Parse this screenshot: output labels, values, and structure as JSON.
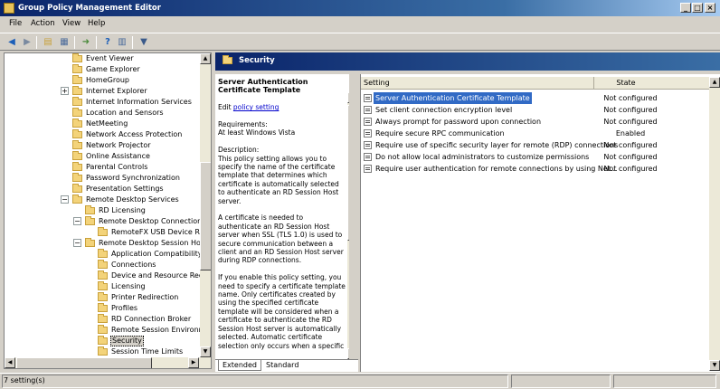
{
  "window": {
    "title": "Group Policy Management Editor"
  },
  "menu": [
    "File",
    "Action",
    "View",
    "Help"
  ],
  "tree": [
    {
      "label": "Event Viewer",
      "indent": 2
    },
    {
      "label": "Game Explorer",
      "indent": 2
    },
    {
      "label": "HomeGroup",
      "indent": 2
    },
    {
      "label": "Internet Explorer",
      "indent": 2,
      "expander": "+"
    },
    {
      "label": "Internet Information Services",
      "indent": 2
    },
    {
      "label": "Location and Sensors",
      "indent": 2
    },
    {
      "label": "NetMeeting",
      "indent": 2
    },
    {
      "label": "Network Access Protection",
      "indent": 2
    },
    {
      "label": "Network Projector",
      "indent": 2
    },
    {
      "label": "Online Assistance",
      "indent": 2
    },
    {
      "label": "Parental Controls",
      "indent": 2
    },
    {
      "label": "Password Synchronization",
      "indent": 2
    },
    {
      "label": "Presentation Settings",
      "indent": 2
    },
    {
      "label": "Remote Desktop Services",
      "indent": 2,
      "expander": "−"
    },
    {
      "label": "RD Licensing",
      "indent": 3
    },
    {
      "label": "Remote Desktop Connection Cli",
      "indent": 3,
      "expander": "−"
    },
    {
      "label": "RemoteFX USB Device Redi",
      "indent": 4
    },
    {
      "label": "Remote Desktop Session Host",
      "indent": 3,
      "expander": "−"
    },
    {
      "label": "Application Compatibility",
      "indent": 4
    },
    {
      "label": "Connections",
      "indent": 4
    },
    {
      "label": "Device and Resource Redire",
      "indent": 4
    },
    {
      "label": "Licensing",
      "indent": 4
    },
    {
      "label": "Printer Redirection",
      "indent": 4
    },
    {
      "label": "Profiles",
      "indent": 4
    },
    {
      "label": "RD Connection Broker",
      "indent": 4
    },
    {
      "label": "Remote Session Environmen",
      "indent": 4
    },
    {
      "label": "Security",
      "indent": 4,
      "selected": true
    },
    {
      "label": "Session Time Limits",
      "indent": 4
    }
  ],
  "right": {
    "header": "Security",
    "description": {
      "title": "Server Authentication Certificate Template",
      "edit_prefix": "Edit ",
      "edit_link": "policy setting",
      "paragraphs": [
        "Requirements:\nAt least Windows Vista",
        "Description:\nThis policy setting allows you to specify the name of the certificate template that determines which certificate is automatically selected to authenticate an RD Session Host server.",
        "A certificate is needed to authenticate an RD Session Host server when SSL (TLS 1.0) is used to secure communication between a client and an RD Session Host server during RDP connections.",
        "If you enable this policy setting, you need to specify a certificate template name. Only certificates created by using the specified certificate template will be considered when a certificate to authenticate the RD Session Host server is automatically selected. Automatic certificate selection only occurs when a specific"
      ]
    },
    "tabs": [
      "Extended",
      "Standard"
    ],
    "columns": {
      "setting": "Setting",
      "state": "State"
    },
    "rows": [
      {
        "name": "Server Authentication Certificate Template",
        "state": "Not configured",
        "selected": true
      },
      {
        "name": "Set client connection encryption level",
        "state": "Not configured"
      },
      {
        "name": "Always prompt for password upon connection",
        "state": "Not configured"
      },
      {
        "name": "Require secure RPC communication",
        "state": "Enabled"
      },
      {
        "name": "Require use of specific security layer for remote (RDP) connections",
        "state": "Not configured"
      },
      {
        "name": "Do not allow local administrators to customize permissions",
        "state": "Not configured"
      },
      {
        "name": "Require user authentication for remote connections by using Net...",
        "state": "Not configured"
      }
    ]
  },
  "status": {
    "text": "7 setting(s)"
  }
}
